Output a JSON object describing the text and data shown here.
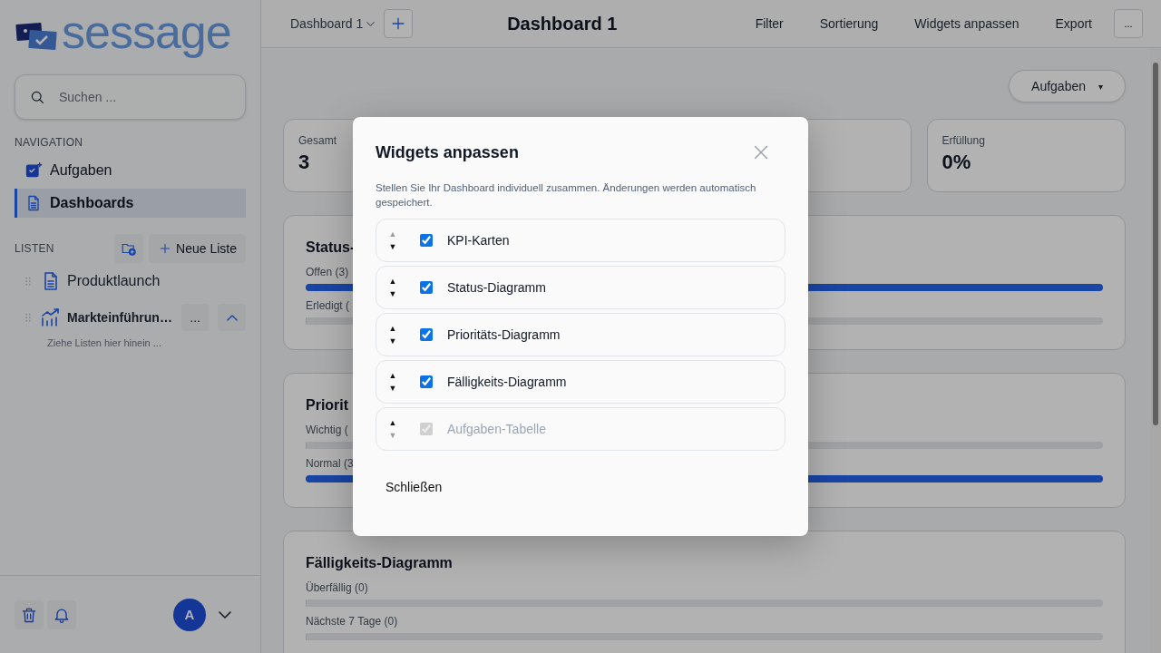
{
  "sidebar": {
    "logo": {
      "text": "sessage"
    },
    "search": {
      "placeholder": "Suchen ..."
    },
    "navigation": {
      "heading": "NAVIGATION",
      "items": [
        {
          "label": "Aufgaben",
          "selected": false
        },
        {
          "label": "Dashboards",
          "selected": true
        }
      ]
    },
    "lists": {
      "heading": "LISTEN",
      "new_button": "Neue Liste",
      "items": [
        {
          "label": "Produktlaunch",
          "bold": false
        },
        {
          "label": "Markteinführun…",
          "bold": true,
          "menu": "...",
          "expanded": true
        }
      ],
      "drop_hint": "Ziehe Listen hier hinein ..."
    },
    "footer": {
      "avatar": "A"
    }
  },
  "header": {
    "dashboard_select": "Dashboard 1",
    "title": "Dashboard 1",
    "actions": [
      "Filter",
      "Sortierung",
      "Widgets anpassen",
      "Export"
    ],
    "more": "..."
  },
  "content": {
    "view_select": {
      "label": "Aufgaben",
      "caret": "▾"
    },
    "kpi_cards": [
      {
        "label": "Gesamt",
        "value": "3"
      },
      {
        "label": "Erfüllung",
        "value": "0%"
      }
    ],
    "charts": [
      {
        "title": "Status-",
        "bars": [
          {
            "label": "Offen (3)",
            "level": 1
          },
          {
            "label": "Erledigt (",
            "level": 0
          }
        ]
      },
      {
        "title": "Priorit",
        "bars": [
          {
            "label": "Wichtig (",
            "level": 0
          },
          {
            "label": "Normal (3",
            "level": 1
          }
        ]
      },
      {
        "title": "Fälligkeits-Diagramm",
        "bars": [
          {
            "label": "Überfällig (0)",
            "level": 0
          },
          {
            "label": "Nächste 7 Tage (0)",
            "level": 0
          }
        ]
      }
    ]
  },
  "dialog": {
    "title": "Widgets anpassen",
    "description": "Stellen Sie Ihr Dashboard individuell zusammen. Änderungen werden automatisch gespeichert.",
    "widgets": [
      {
        "label": "KPI-Karten",
        "checked": true,
        "disabled": false,
        "up": {
          "glyph": "▲",
          "disabled": true
        },
        "down": {
          "glyph": "▼",
          "disabled": false
        }
      },
      {
        "label": "Status-Diagramm",
        "checked": true,
        "disabled": false,
        "up": {
          "glyph": "▲",
          "disabled": false
        },
        "down": {
          "glyph": "▼",
          "disabled": false
        }
      },
      {
        "label": "Prioritäts-Diagramm",
        "checked": true,
        "disabled": false,
        "up": {
          "glyph": "▲",
          "disabled": false
        },
        "down": {
          "glyph": "▼",
          "disabled": false
        }
      },
      {
        "label": "Fälligkeits-Diagramm",
        "checked": true,
        "disabled": false,
        "up": {
          "glyph": "▲",
          "disabled": false
        },
        "down": {
          "glyph": "▼",
          "disabled": false
        }
      },
      {
        "label": "Aufgaben-Tabelle",
        "checked": true,
        "disabled": true,
        "up": {
          "glyph": "▲",
          "disabled": false
        },
        "down": {
          "glyph": "▼",
          "disabled": true
        }
      }
    ],
    "close_button": "Schließen"
  }
}
